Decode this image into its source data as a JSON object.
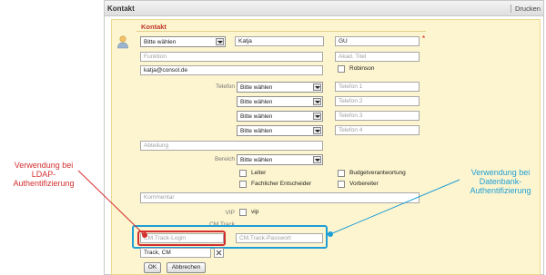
{
  "window": {
    "title": "Kontakt",
    "print_label": "Drucken"
  },
  "section": {
    "title": "Kontakt"
  },
  "fields": {
    "salutation": "Bitte wählen",
    "firstname": "Katja",
    "lastname": "GU",
    "function_placeholder": "Funktion",
    "academic_title_placeholder": "Akad. Titel",
    "email": "katja@consol.de",
    "robinson_label": "Robinson",
    "phone_label": "Telefon",
    "phone_types": [
      "Bitte wählen",
      "Bitte wählen",
      "Bitte wählen",
      "Bitte wählen"
    ],
    "phone_placeholders": [
      "Telefon 1",
      "Telefon 2",
      "Telefon 3",
      "Telefon 4"
    ],
    "department_placeholder": "Abteilung",
    "area_label": "Bereich",
    "area_value": "Bitte wählen",
    "checkboxes": [
      "Leiter",
      "Budgetverantwortung",
      "Fachlicher Entscheider",
      "Vorbereiter"
    ],
    "comment_placeholder": "Kommentar",
    "vip_label": "VIP",
    "vip_option": "vip",
    "cmtrack_label": "CM.Track",
    "login_placeholder": "CM.Track-Login",
    "password_placeholder": "CM.Track-Passwort",
    "owner_value": "Track, CM"
  },
  "buttons": {
    "ok": "OK",
    "cancel": "Abbrechen"
  },
  "annotations": {
    "ldap": "Verwendung bei\nLDAP-\nAuthentifizierung",
    "database": "Verwendung bei\nDatenbank-\nAuthentifizierung"
  },
  "colors": {
    "ldap": "#d32f2f",
    "database": "#1e9ed6",
    "form_bg": "#fdf5cf",
    "section_title": "#c0392b"
  }
}
